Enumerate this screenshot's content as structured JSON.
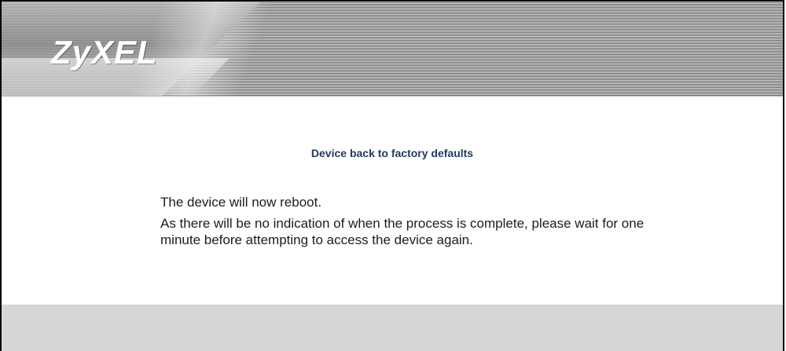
{
  "header": {
    "logo_text": "ZyXEL"
  },
  "content": {
    "title": "Device back to factory defaults",
    "message_line_1": "The device will now reboot.",
    "message_line_2": "As there will be no indication of when the process is complete, please wait for one minute before attempting to access the device again."
  },
  "colors": {
    "title": "#1f3a5f",
    "text": "#1c1c1c",
    "footer": "#d6d6d6"
  }
}
